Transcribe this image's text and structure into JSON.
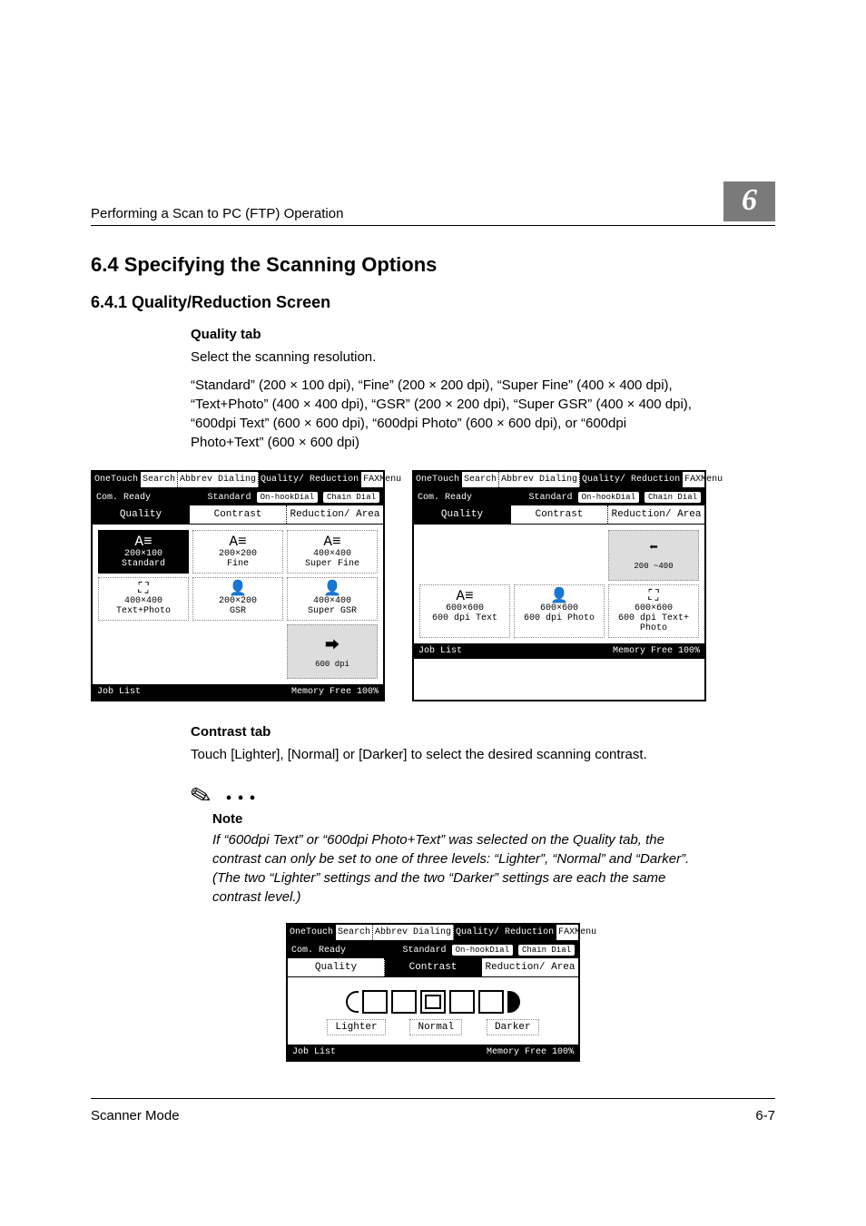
{
  "running_head": {
    "left": "Performing a Scan to PC (FTP) Operation",
    "chapter": "6"
  },
  "section_heading": "6.4    Specifying the Scanning Options",
  "subsection_heading": "6.4.1   Quality/Reduction Screen",
  "quality": {
    "title": "Quality tab",
    "intro": "Select the scanning resolution.",
    "detail": "“Standard” (200 × 100 dpi), “Fine” (200 × 200 dpi), “Super Fine” (400 × 400 dpi), “Text+Photo” (400 × 400 dpi), “GSR” (200 × 200 dpi), “Super GSR” (400 × 400 dpi), “600dpi Text” (600 × 600 dpi), “600dpi Photo” (600 × 600 dpi), or “600dpi Photo+Text” (600 × 600 dpi)"
  },
  "lcd_common": {
    "tabs": [
      "OneTouch",
      "Search",
      "Abbrev Dialing",
      "Quality/ Reduction",
      "FAXMenu"
    ],
    "status_left": "Com. Ready",
    "status_mid": "Standard",
    "status_btn1": "On-hookDial",
    "status_btn2": "Chain Dial",
    "subtabs": [
      "Quality",
      "Contrast",
      "Reduction/ Area"
    ],
    "joblist": "Job List",
    "memory": "Memory Free 100%"
  },
  "screen1": {
    "standard": "Standard",
    "std_sub": "200×100",
    "fine": "Fine",
    "fine_sub": "200×200",
    "superfine": "Super Fine",
    "sf_sub": "400×400",
    "arrow_sub": "600 dpi",
    "textphoto": "Text+Photo",
    "tp_sub": "400×400",
    "gsr": "GSR",
    "gsr_sub": "200×200",
    "sgsr": "Super GSR",
    "sgsr_sub": "400×400"
  },
  "screen2": {
    "arrow_sub": "200 ~400",
    "a600": "600×600",
    "b600": "600×600",
    "c600": "600×600",
    "text600": "600 dpi Text",
    "photo600": "600 dpi Photo",
    "tp600": "600 dpi Text+ Photo"
  },
  "contrast": {
    "title": "Contrast tab",
    "body": "Touch [Lighter], [Normal] or [Darker] to select the desired scanning contrast."
  },
  "note": {
    "label": "Note",
    "body": "If “600dpi Text” or “600dpi Photo+Text” was selected on the Quality tab, the contrast can only be set to one of three levels: “Lighter”, “Normal” and “Darker”. (The two “Lighter” settings and the two “Darker” settings are each the same contrast level.)"
  },
  "contrast_labels": {
    "lighter": "Lighter",
    "normal": "Normal",
    "darker": "Darker"
  },
  "footer": {
    "left": "Scanner Mode",
    "right": "6-7"
  }
}
